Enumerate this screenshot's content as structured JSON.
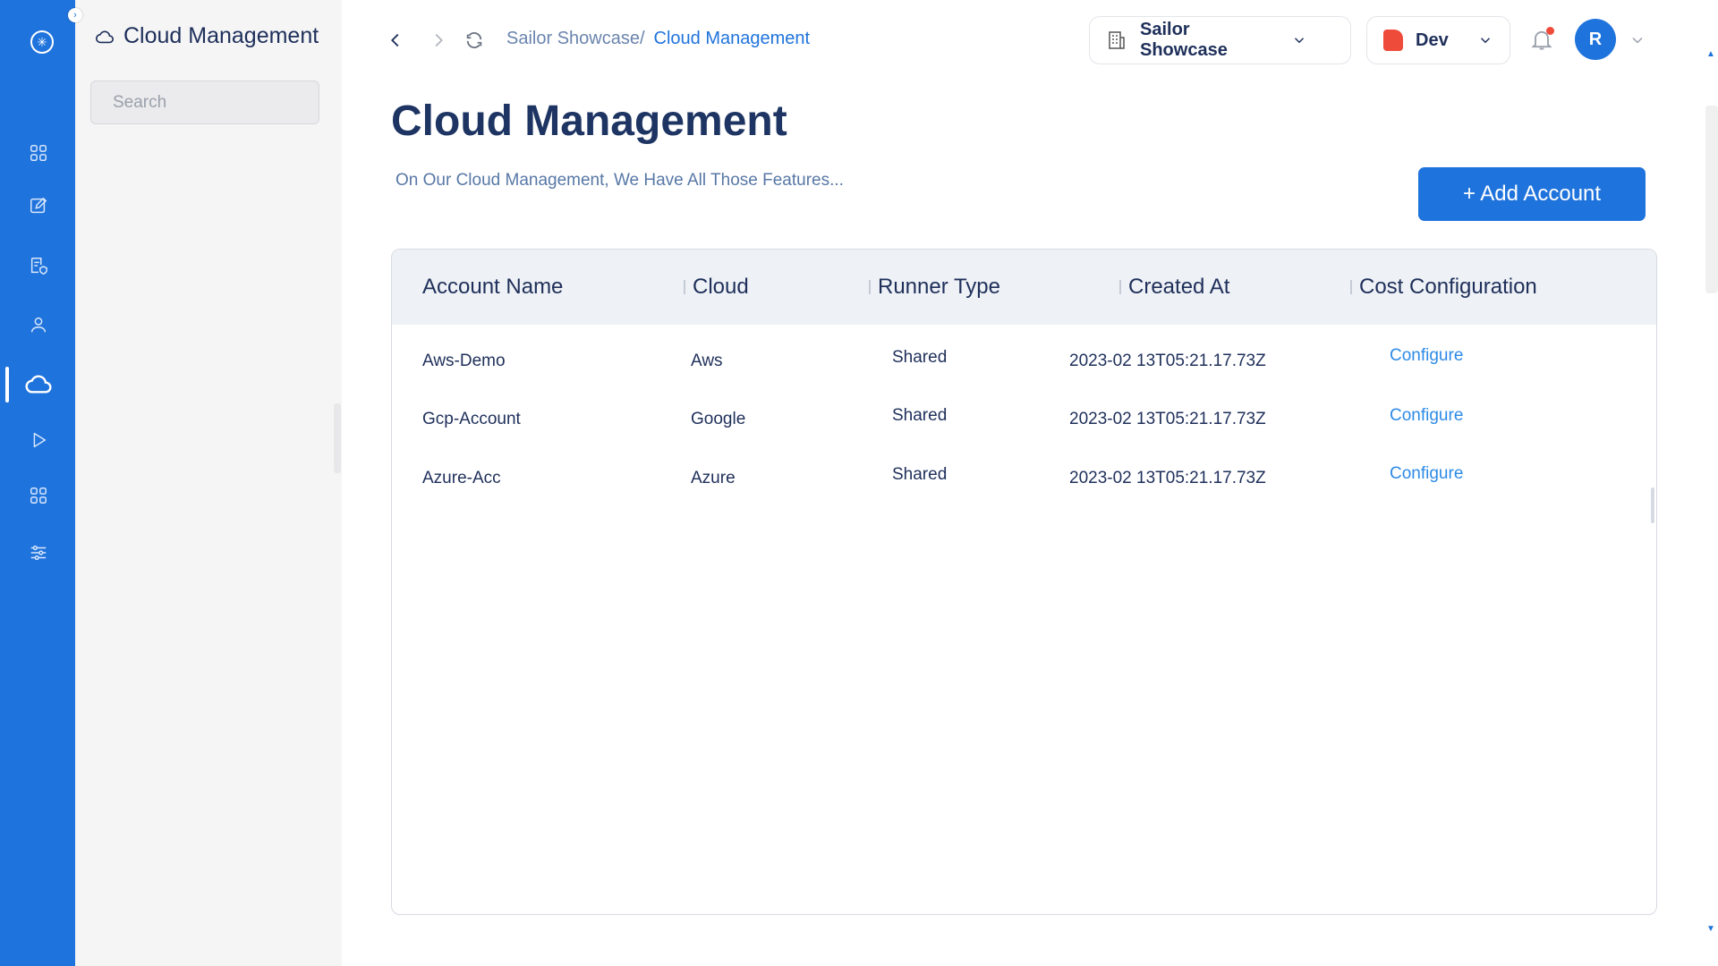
{
  "app": {
    "accent": "#1f73dc",
    "logo_icon": "logo-icon"
  },
  "rail": {
    "items": [
      {
        "icon": "grid-icon"
      },
      {
        "icon": "edit-icon"
      },
      {
        "icon": "document-shield-icon"
      },
      {
        "icon": "user-icon"
      },
      {
        "icon": "cloud-icon",
        "active": true
      },
      {
        "icon": "play-icon"
      },
      {
        "icon": "apps-icon"
      },
      {
        "icon": "sliders-icon"
      }
    ]
  },
  "sidebar": {
    "title": "Cloud Management",
    "search_placeholder": "Search"
  },
  "topbar": {
    "breadcrumb": [
      "Sailor Showcase/",
      "Cloud Management"
    ],
    "org_label": "Sailor Showcase",
    "env_label": "Dev",
    "env_color": "#ef4b3b",
    "avatar_initial": "R"
  },
  "page": {
    "title": "Cloud Management",
    "subtitle": "On Our Cloud Management, We Have All Those Features...",
    "add_button": "+ Add Account"
  },
  "table": {
    "columns": [
      "Account Name",
      "Cloud",
      "Runner Type",
      "Created At",
      "Cost Configuration"
    ],
    "rows": [
      {
        "account": "Aws-Demo",
        "cloud": "Aws",
        "runner": "Shared",
        "created": "2023-02 13T05:21.17.73Z",
        "cost": "Configure"
      },
      {
        "account": "Gcp-Account",
        "cloud": "Google",
        "runner": "Shared",
        "created": "2023-02 13T05:21.17.73Z",
        "cost": "Configure"
      },
      {
        "account": "Azure-Acc",
        "cloud": "Azure",
        "runner": "Shared",
        "created": "2023-02 13T05:21.17.73Z",
        "cost": "Configure"
      }
    ]
  }
}
